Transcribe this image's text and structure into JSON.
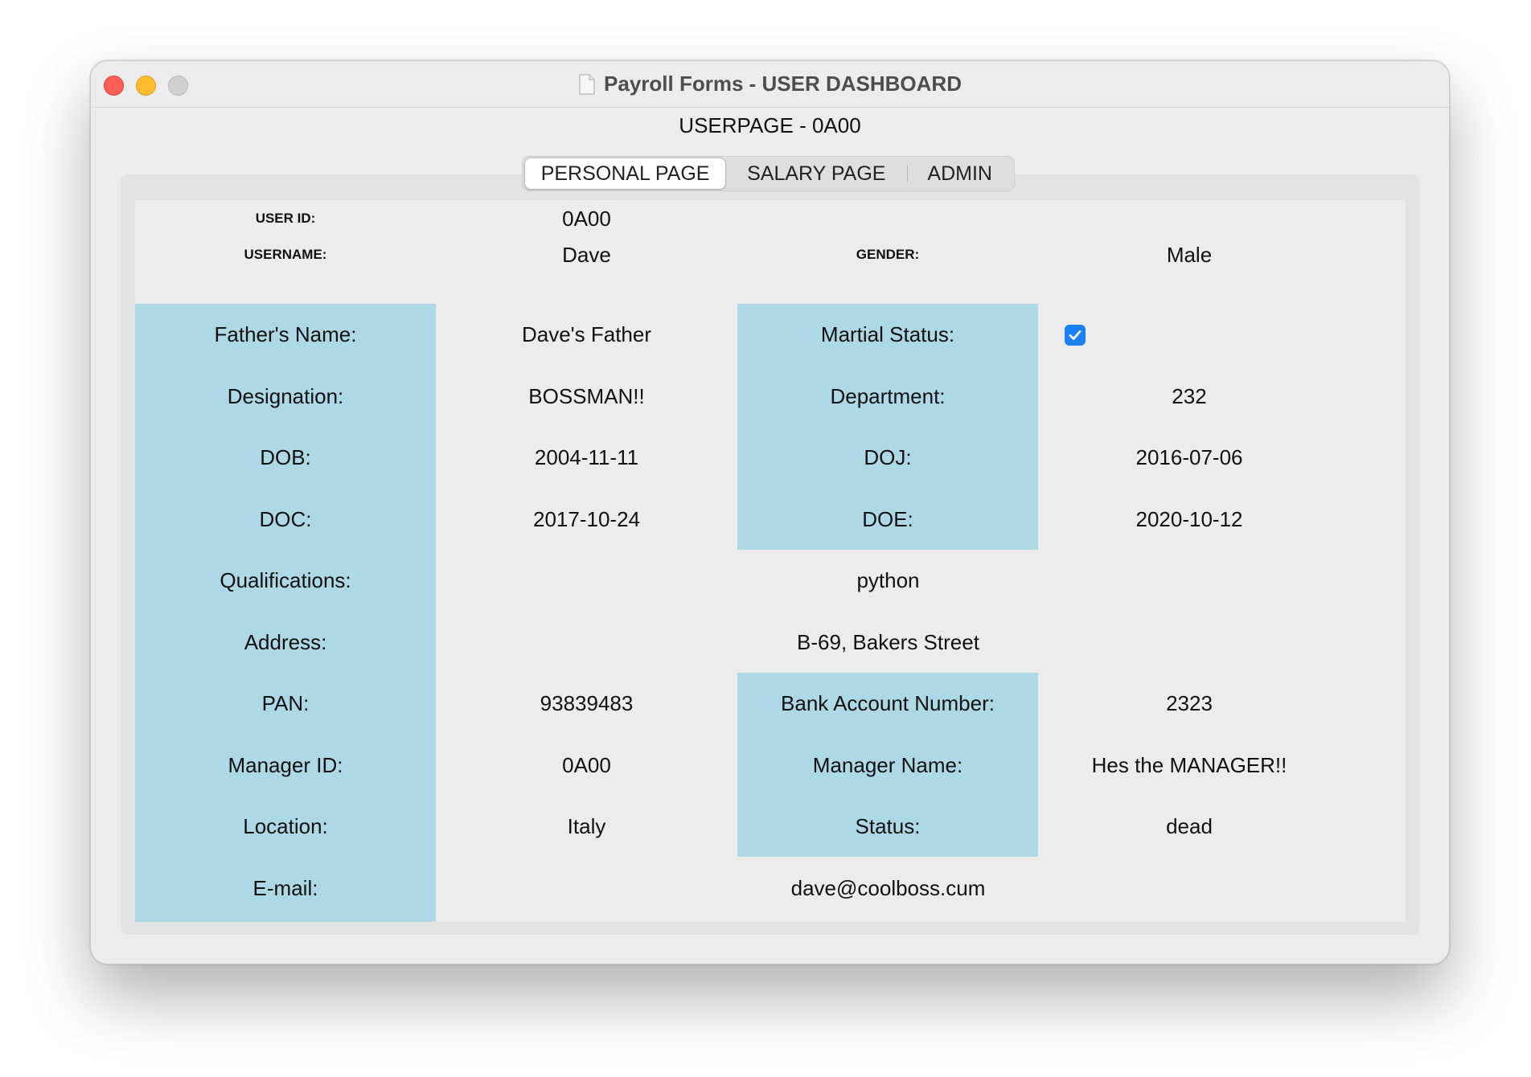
{
  "window": {
    "title": "Payroll Forms - USER DASHBOARD",
    "heading": "USERPAGE - 0A00"
  },
  "tabs": [
    {
      "label": "PERSONAL PAGE",
      "active": true
    },
    {
      "label": "SALARY PAGE",
      "active": false
    },
    {
      "label": "ADMIN",
      "active": false
    }
  ],
  "header": {
    "user_id_label": "USER ID:",
    "user_id_value": "0A00",
    "username_label": "USERNAME:",
    "username_value": "Dave",
    "gender_label": "GENDER:",
    "gender_value": "Male"
  },
  "fields": {
    "fathers_name": {
      "label": "Father's Name:",
      "value": "Dave's Father"
    },
    "marital_status": {
      "label": "Martial Status:",
      "checked": true
    },
    "designation": {
      "label": "Designation:",
      "value": "BOSSMAN!!"
    },
    "department": {
      "label": "Department:",
      "value": "232"
    },
    "dob": {
      "label": "DOB:",
      "value": "2004-11-11"
    },
    "doj": {
      "label": "DOJ:",
      "value": "2016-07-06"
    },
    "doc": {
      "label": "DOC:",
      "value": "2017-10-24"
    },
    "doe": {
      "label": "DOE:",
      "value": "2020-10-12"
    },
    "qualifications": {
      "label": "Qualifications:",
      "value": "python"
    },
    "address": {
      "label": "Address:",
      "value": "B-69, Bakers Street"
    },
    "pan": {
      "label": "PAN:",
      "value": "93839483"
    },
    "bank_account": {
      "label": "Bank Account Number:",
      "value": "2323"
    },
    "manager_id": {
      "label": "Manager ID:",
      "value": "0A00"
    },
    "manager_name": {
      "label": "Manager Name:",
      "value": "Hes the MANAGER!!"
    },
    "location": {
      "label": "Location:",
      "value": "Italy"
    },
    "status": {
      "label": "Status:",
      "value": "dead"
    },
    "email": {
      "label": "E-mail:",
      "value": "dave@coolboss.cum"
    }
  },
  "colors": {
    "label_background": "#add8e6",
    "checkbox_accent": "#1a80f5"
  }
}
